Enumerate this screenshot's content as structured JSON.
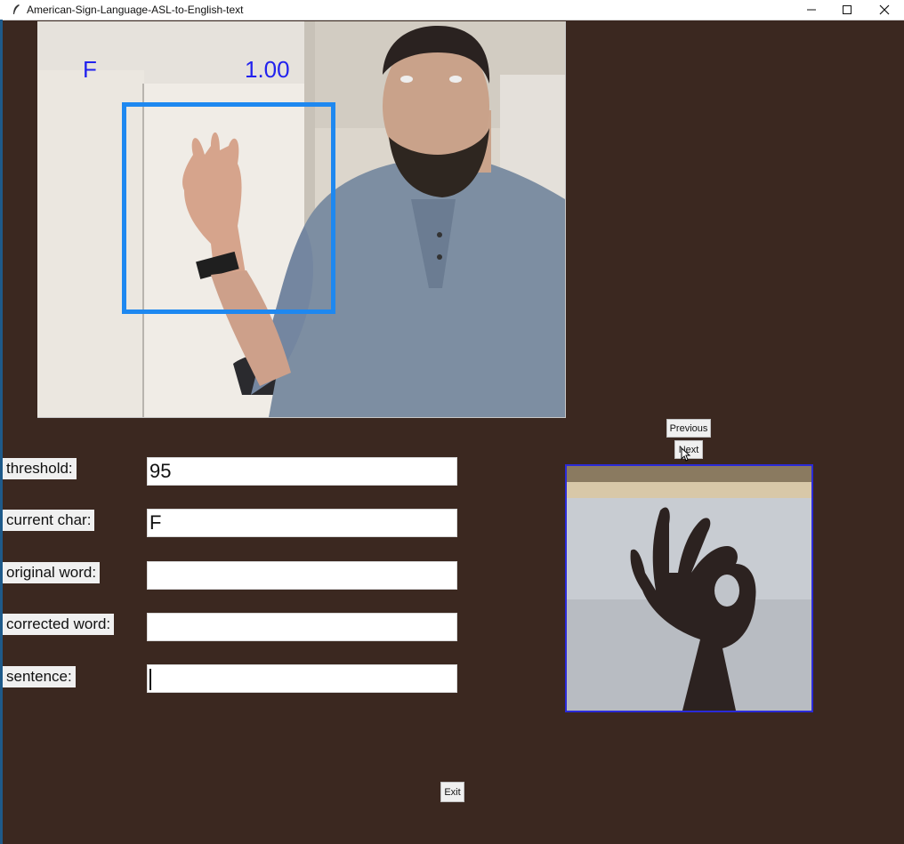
{
  "window": {
    "title": "American-Sign-Language-ASL-to-English-text",
    "icon": "feather-icon",
    "controls": [
      "minimize-icon",
      "maximize-icon",
      "close-icon"
    ]
  },
  "detection": {
    "letter": "F",
    "score": "1.00",
    "box_color": "#1e88f0",
    "text_color": "#2222ee"
  },
  "nav": {
    "previous_label": "Previous",
    "next_label": "Next"
  },
  "fields": {
    "threshold": {
      "label": "threshold:",
      "value": "95"
    },
    "current_char": {
      "label": "current char:",
      "value": "F"
    },
    "original_word": {
      "label": "original word:",
      "value": ""
    },
    "corrected_word": {
      "label": "corrected word:",
      "value": ""
    },
    "sentence": {
      "label": "sentence:",
      "value": ""
    }
  },
  "exit_label": "Exit",
  "colors": {
    "background": "#3b2820",
    "hand_panel_border": "#2a2ad8"
  }
}
